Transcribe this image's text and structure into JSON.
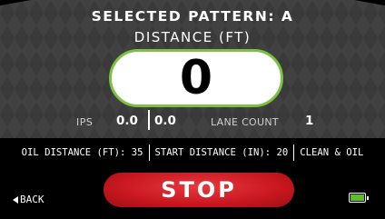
{
  "header": {
    "title": "SELECTED PATTERN: A",
    "subtitle": "DISTANCE (FT)"
  },
  "distance_display": {
    "value": "0"
  },
  "ips": {
    "label": "IPS",
    "value_left": "0.0",
    "value_right": "0.0"
  },
  "lane_count": {
    "label": "LANE COUNT",
    "value": "1"
  },
  "info_bar": {
    "oil_distance": "OIL DISTANCE (FT): 35",
    "start_distance": "START DISTANCE (IN): 20",
    "mode": "CLEAN & OIL"
  },
  "controls": {
    "back_label": "BACK",
    "stop_label": "STOP"
  },
  "battery": {
    "level": 1.0,
    "color": "#5bbf2a"
  },
  "colors": {
    "accent_green": "#7bc142",
    "stop_red": "#d0202a"
  }
}
